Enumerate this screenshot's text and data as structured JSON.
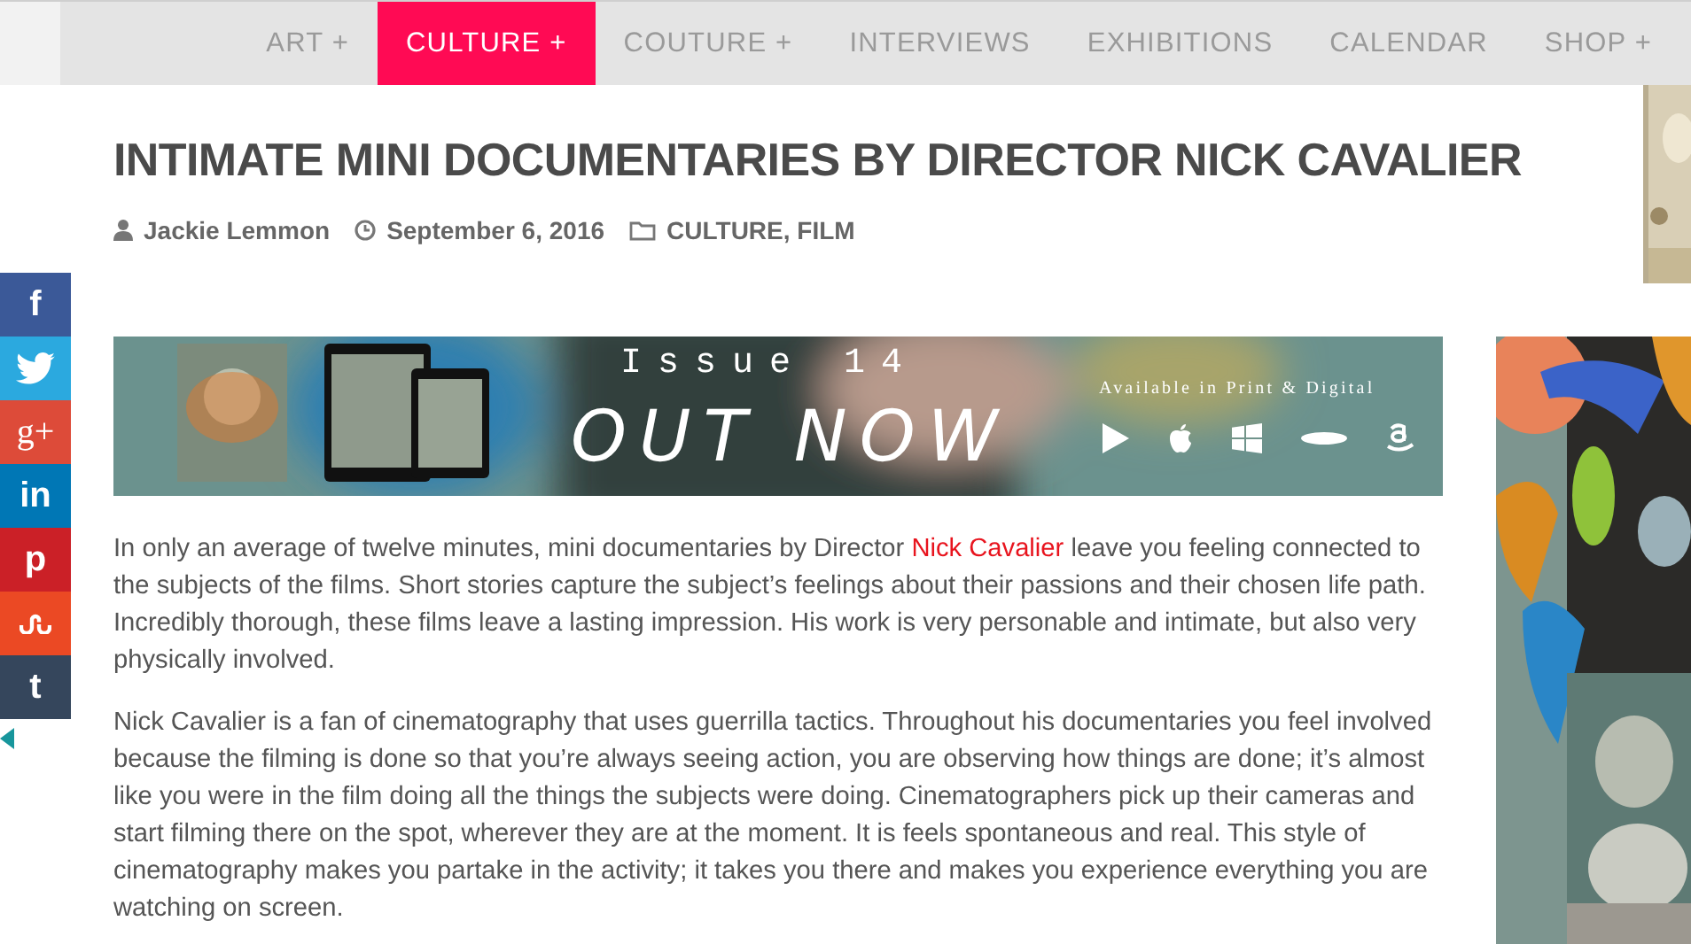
{
  "nav": {
    "items": [
      {
        "label": "ART +",
        "selected": false
      },
      {
        "label": "CULTURE +",
        "selected": true
      },
      {
        "label": "COUTURE +",
        "selected": false
      },
      {
        "label": "INTERVIEWS",
        "selected": false
      },
      {
        "label": "EXHIBITIONS",
        "selected": false
      },
      {
        "label": "CALENDAR",
        "selected": false
      },
      {
        "label": "SHOP +",
        "selected": false
      }
    ]
  },
  "post": {
    "title": "INTIMATE MINI DOCUMENTARIES BY DIRECTOR NICK CAVALIER",
    "meta": [
      {
        "kind": "author",
        "text": "Jackie Lemmon"
      },
      {
        "kind": "date",
        "text": "September 6, 2016"
      },
      {
        "kind": "categories",
        "text": "CULTURE, FILM"
      }
    ]
  },
  "share_bar": {
    "buttons": [
      {
        "kind": "facebook",
        "glyph": "f",
        "color": "#3b5998"
      },
      {
        "kind": "twitter",
        "color": "#2ba9df"
      },
      {
        "kind": "googleplus",
        "glyph": "g+",
        "color": "#dd4b39"
      },
      {
        "kind": "linkedin",
        "glyph": "in",
        "color": "#0077b5"
      },
      {
        "kind": "pinterest",
        "glyph": "p",
        "color": "#cb2027"
      },
      {
        "kind": "stumbleupon",
        "color": "#eb4924"
      },
      {
        "kind": "tumblr",
        "glyph": "t",
        "color": "#35465c"
      }
    ]
  },
  "banner": {
    "kind": "picture",
    "issue": "Issue 14",
    "headline": "OUT NOW",
    "availability": "Available in Print & Digital"
  },
  "article": {
    "paragraphs": [
      [
        {
          "text": "In only an average of twelve minutes, mini documentaries by Director "
        },
        {
          "kind": "link",
          "text": "Nick Cavalier"
        },
        {
          "text": " leave you feeling connected to the subjects of the films. Short stories capture the subject’s feelings about their passions and their chosen life path. Incredibly thorough, these films leave a lasting impression. His work is very personable and intimate, but also very physically involved."
        }
      ],
      [
        {
          "text": "Nick Cavalier is a fan of cinematography that uses guerrilla tactics. Throughout his documentaries you feel involved because the filming is done so that you’re always seeing action, you are observing how things are done; it’s almost like you were in the film doing all the things the subjects were doing. Cinematographers pick up their cameras and start filming there on the spot, wherever they are at the moment. It is feels spontaneous and real. This style of cinematography makes you partake in the activity; it takes you there and makes you experience everything you are watching on screen."
        }
      ]
    ]
  }
}
